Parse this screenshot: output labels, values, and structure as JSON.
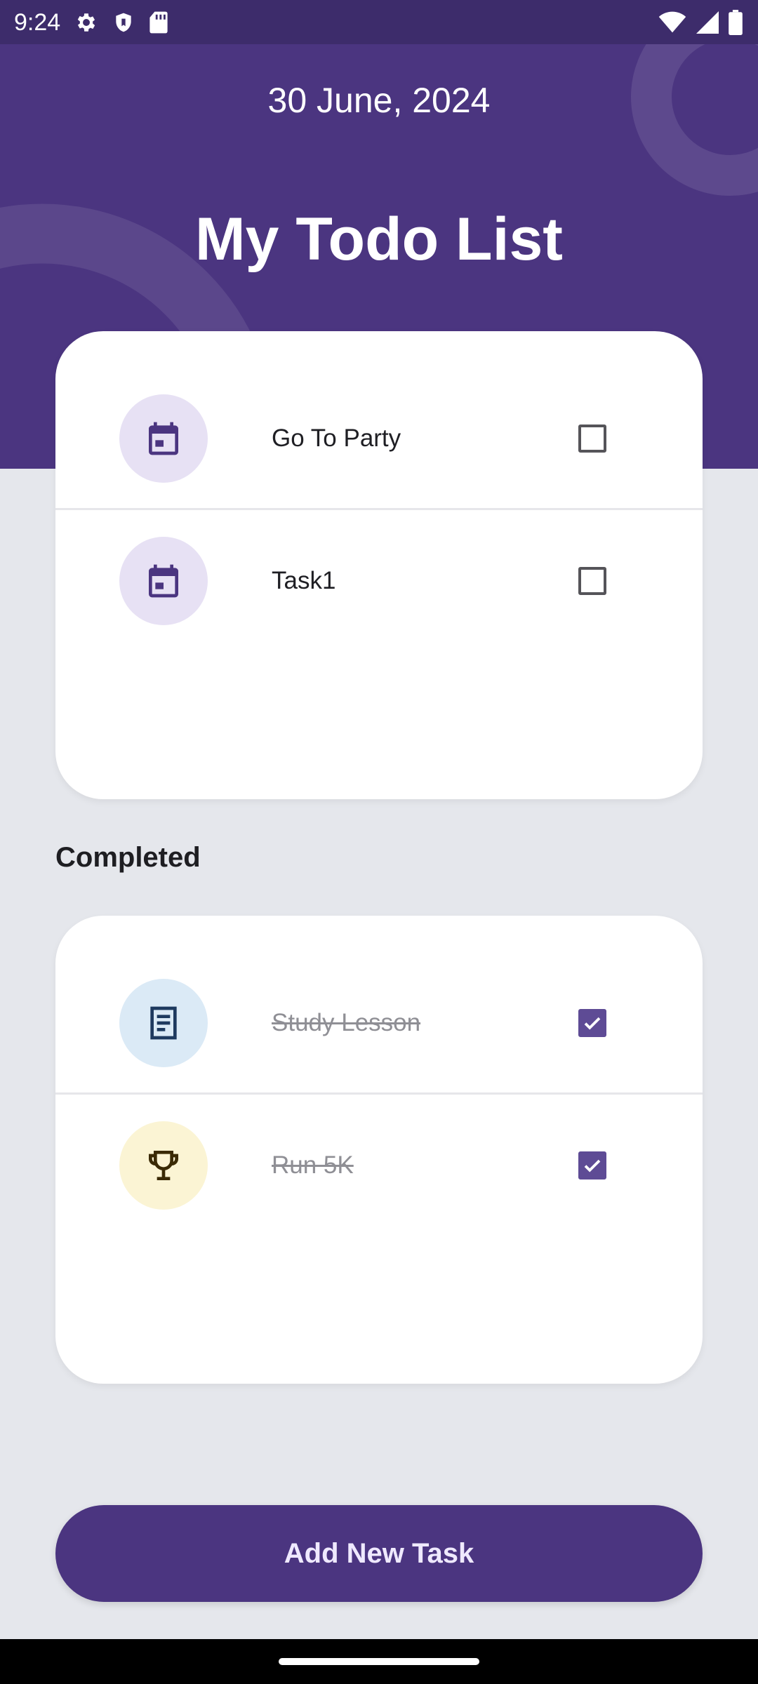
{
  "status_bar": {
    "time": "9:24",
    "icons_left": [
      "gear-icon",
      "shield-icon",
      "sd-card-icon"
    ],
    "icons_right": [
      "wifi-icon",
      "signal-icon",
      "battery-icon"
    ]
  },
  "header": {
    "date": "30 June, 2024",
    "title": "My Todo List"
  },
  "todo": {
    "items": [
      {
        "label": "Go To Party",
        "icon": "calendar-icon",
        "checked": false
      },
      {
        "label": "Task1",
        "icon": "calendar-icon",
        "checked": false
      }
    ]
  },
  "completed": {
    "heading": "Completed",
    "items": [
      {
        "label": "Study Lesson",
        "icon": "notes-icon",
        "checked": true
      },
      {
        "label": "Run 5K",
        "icon": "trophy-icon",
        "checked": true
      }
    ]
  },
  "actions": {
    "add_task_label": "Add New Task"
  },
  "colors": {
    "primary": "#4b3580",
    "status_bar": "#3d2c6b",
    "background": "#e5e7ec",
    "checkbox_checked": "#5e4b95",
    "calendar_circle": "#e7e1f4",
    "notes_circle": "#dbeaf6",
    "trophy_circle": "#fbf4d4"
  }
}
